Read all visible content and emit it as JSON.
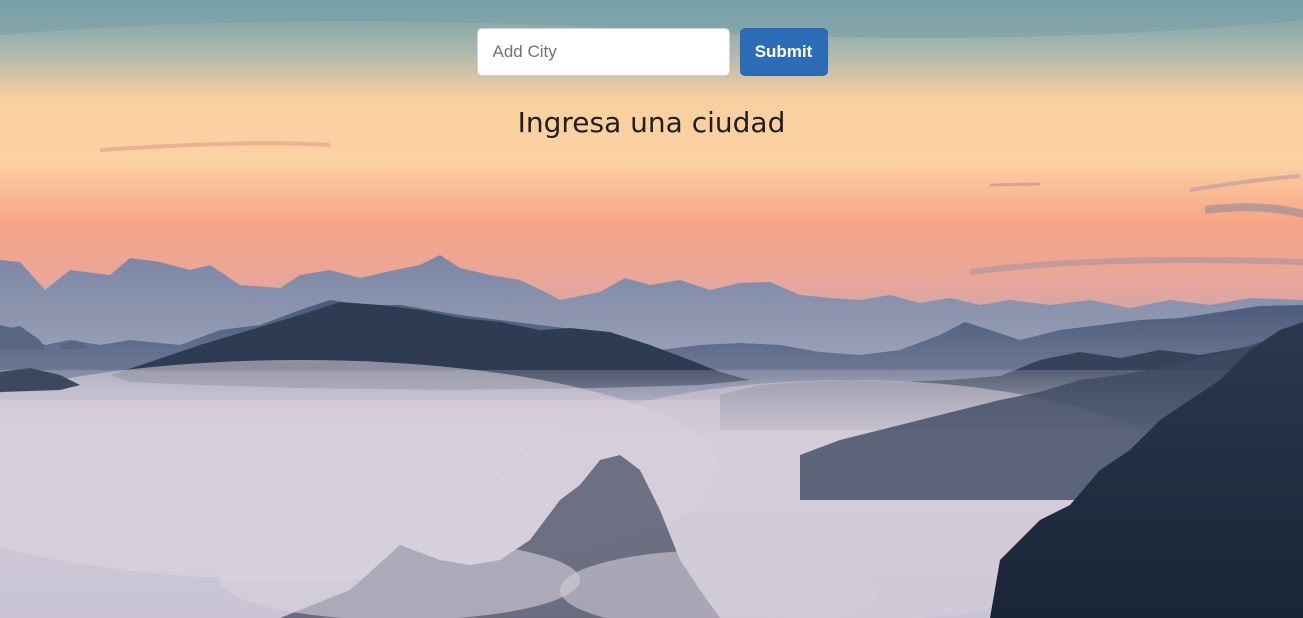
{
  "search": {
    "placeholder": "Add City",
    "value": ""
  },
  "submit_label": "Submit",
  "heading": "Ingresa una ciudad",
  "background": {
    "description_icon": "mountain-landscape-background",
    "colors": {
      "sky_top": "#7aa3ad",
      "sky_mid": "#fbc79a",
      "sky_horizon": "#f5a08a",
      "mist": "#cfc8d8",
      "mountain_far": "#6f7f9c",
      "mountain_near": "#2c3a4f"
    }
  },
  "colors": {
    "accent": "#2d6db8"
  }
}
